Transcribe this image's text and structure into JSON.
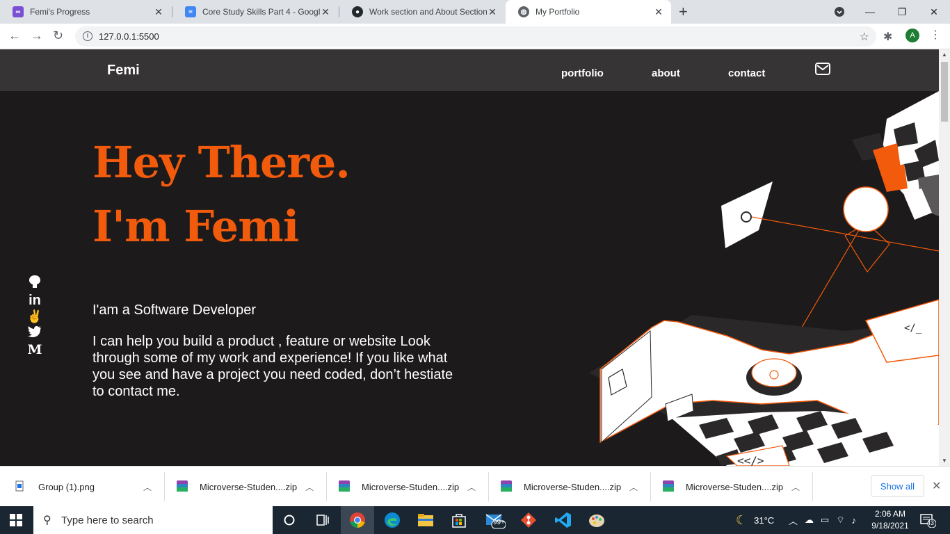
{
  "browser": {
    "tabs": [
      {
        "title": "Femi's Progress",
        "icon": "monitor-icon",
        "color": "#7b4fd4",
        "active": false
      },
      {
        "title": "Core Study Skills Part 4 - Google",
        "icon": "google-docs-icon",
        "color": "#4285f4",
        "active": false
      },
      {
        "title": "Work section and About Section",
        "icon": "github-icon",
        "color": "#24292e",
        "active": false
      },
      {
        "title": "My Portfolio",
        "icon": "globe-icon",
        "color": "#5f6368",
        "active": true
      }
    ],
    "url": "127.0.0.1:5500",
    "profile_initial": "A"
  },
  "site": {
    "logo": "Femi",
    "nav": [
      "portfolio",
      "about",
      "contact"
    ],
    "hero_line1": "Hey There.",
    "hero_line2": "I'm Femi",
    "tagline": "I'am a Software Developer",
    "description": "I can help you build a product , feature or website Look through some of my work and experience! If you like what you see and have a project you need coded, don’t hestiate to contact me.",
    "social": [
      "github-icon",
      "linkedin-icon",
      "angellist-icon",
      "twitter-icon",
      "medium-icon"
    ],
    "accent_color": "#f25a0c",
    "art_code_top": "</_",
    "art_code_bottom": "<</>"
  },
  "downloads": {
    "items": [
      "Group (1).png",
      "Microverse-Studen....zip",
      "Microverse-Studen....zip",
      "Microverse-Studen....zip",
      "Microverse-Studen....zip"
    ],
    "show_all": "Show all"
  },
  "taskbar": {
    "search_placeholder": "Type here to search",
    "mail_badge": "99+",
    "temperature": "31°C",
    "time": "2:06 AM",
    "date": "9/18/2021",
    "notification_count": "43"
  }
}
